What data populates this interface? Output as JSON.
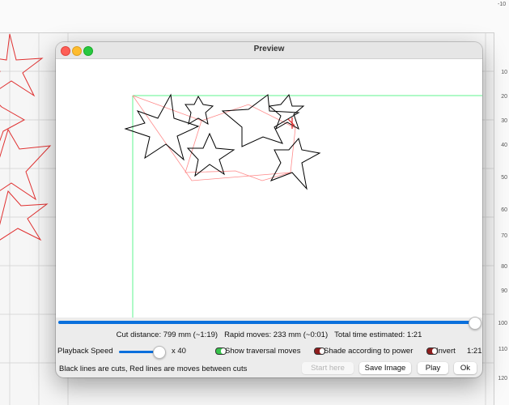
{
  "window": {
    "title": "Preview"
  },
  "canvas": {
    "grid_color": "#5ff58f",
    "cut_color": "#000000",
    "move_color": "#ff8a8a"
  },
  "background": {
    "ruler_right_ticks": [
      "-10",
      "10",
      "20",
      "30",
      "40",
      "50",
      "60",
      "70",
      "80",
      "90",
      "100",
      "110",
      "120"
    ],
    "shape_color": "#e03030"
  },
  "playback": {
    "progress": 1.0
  },
  "stats": {
    "cut_distance": "Cut distance: 799 mm (~1:19)",
    "rapid_moves": "Rapid moves: 233 mm (~0:01)",
    "total_time": "Total time estimated: 1:21"
  },
  "controls": {
    "speed_label": "Playback Speed",
    "speed_value": "x 40",
    "speed_level": 0.8,
    "show_traversal": "Show traversal moves",
    "shade_power": "Shade according to power",
    "invert": "Invert",
    "time_display": "1:21"
  },
  "footer": {
    "hint": "Black lines are cuts, Red lines are moves between cuts",
    "start_here": "Start here",
    "save_image": "Save Image",
    "play": "Play",
    "ok": "Ok"
  }
}
